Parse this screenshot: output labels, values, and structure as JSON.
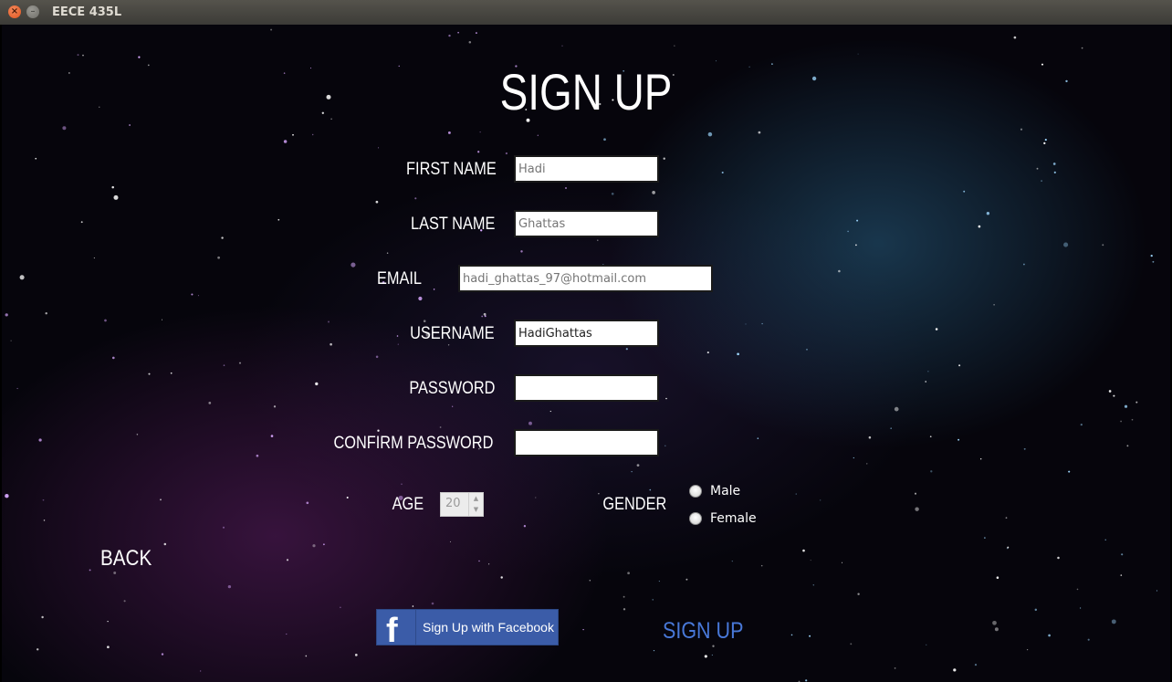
{
  "window": {
    "title": "EECE 435L",
    "close_glyph": "×",
    "min_glyph": "–"
  },
  "page": {
    "heading": "SIGN UP"
  },
  "form": {
    "first_name": {
      "label": "FIRST NAME",
      "placeholder": "Hadi",
      "value": ""
    },
    "last_name": {
      "label": "LAST NAME",
      "placeholder": "Ghattas",
      "value": ""
    },
    "email": {
      "label": "EMAIL",
      "placeholder": "hadi_ghattas_97@hotmail.com",
      "value": ""
    },
    "username": {
      "label": "USERNAME",
      "placeholder": "",
      "value": "HadiGhattas"
    },
    "password": {
      "label": "PASSWORD",
      "value": ""
    },
    "confirm_password": {
      "label": "CONFIRM PASSWORD",
      "value": ""
    },
    "age": {
      "label": "AGE",
      "value": "20"
    },
    "gender": {
      "label": "GENDER",
      "options": [
        "Male",
        "Female"
      ]
    }
  },
  "actions": {
    "back": "BACK",
    "facebook": "Sign Up with Facebook",
    "facebook_glyph": "f",
    "signup": "SIGN UP"
  },
  "colors": {
    "signup_link": "#4878d8",
    "facebook_blue": "#3b5ca8"
  }
}
